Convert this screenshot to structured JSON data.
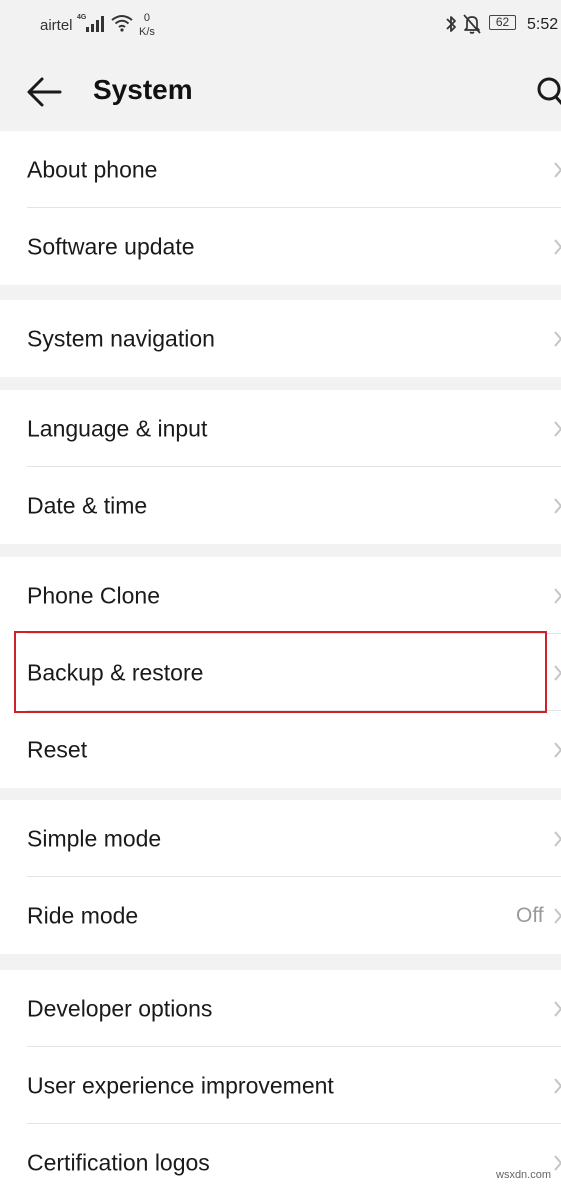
{
  "status_bar": {
    "carrier": "airtel",
    "network": "4G",
    "speed_value": "0",
    "speed_unit": "K/s",
    "battery": "62",
    "time": "5:52"
  },
  "header": {
    "title": "System",
    "back_icon": "arrow-left-icon",
    "search_icon": "search-icon"
  },
  "groups": [
    {
      "items": [
        {
          "label": "About phone"
        },
        {
          "label": "Software update"
        }
      ]
    },
    {
      "items": [
        {
          "label": "System navigation"
        }
      ]
    },
    {
      "items": [
        {
          "label": "Language & input"
        },
        {
          "label": "Date & time"
        }
      ]
    },
    {
      "items": [
        {
          "label": "Phone Clone"
        },
        {
          "label": "Backup & restore",
          "highlighted": true
        },
        {
          "label": "Reset"
        }
      ]
    },
    {
      "items": [
        {
          "label": "Simple mode"
        },
        {
          "label": "Ride mode",
          "value": "Off"
        }
      ]
    },
    {
      "items": [
        {
          "label": "Developer options"
        },
        {
          "label": "User experience improvement"
        },
        {
          "label": "Certification logos"
        }
      ]
    }
  ],
  "highlight_color": "#d0202a",
  "watermark": "wsxdn.com"
}
